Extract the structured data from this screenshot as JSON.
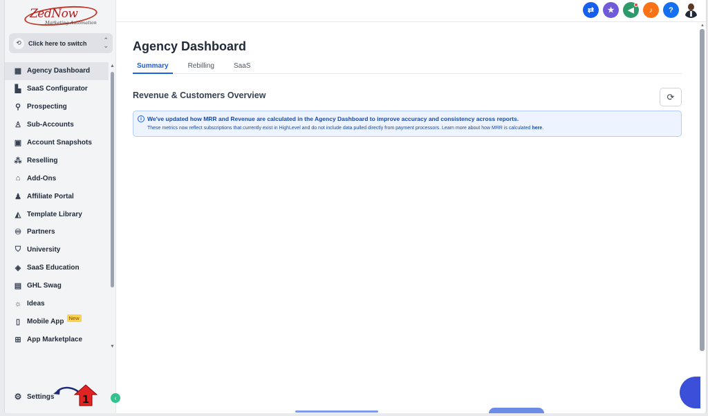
{
  "logo": {
    "brand": "ZedNow",
    "tagline": "Marketing Automation"
  },
  "switcher": {
    "label": "Click here to switch"
  },
  "sidebar": {
    "items": [
      {
        "label": "Agency Dashboard",
        "icon": "dashboard-icon",
        "glyph": "▦",
        "active": true
      },
      {
        "label": "SaaS Configurator",
        "icon": "bar-chart-icon",
        "glyph": "▙"
      },
      {
        "label": "Prospecting",
        "icon": "users-search-icon",
        "glyph": "⚲"
      },
      {
        "label": "Sub-Accounts",
        "icon": "user-icon",
        "glyph": "♙"
      },
      {
        "label": "Account Snapshots",
        "icon": "image-icon",
        "glyph": "▣"
      },
      {
        "label": "Reselling",
        "icon": "network-icon",
        "glyph": "⁂"
      },
      {
        "label": "Add-Ons",
        "icon": "bag-icon",
        "glyph": "⌂"
      },
      {
        "label": "Affiliate Portal",
        "icon": "group-icon",
        "glyph": "♟"
      },
      {
        "label": "Template Library",
        "icon": "shapes-icon",
        "glyph": "◭"
      },
      {
        "label": "Partners",
        "icon": "handshake-icon",
        "glyph": "♾"
      },
      {
        "label": "University",
        "icon": "graduation-cap-icon",
        "glyph": "⛉"
      },
      {
        "label": "SaaS Education",
        "icon": "cube-icon",
        "glyph": "◈"
      },
      {
        "label": "GHL Swag",
        "icon": "store-icon",
        "glyph": "▤"
      },
      {
        "label": "Ideas",
        "icon": "bulb-icon",
        "glyph": "☼"
      },
      {
        "label": "Mobile App",
        "icon": "phone-icon",
        "glyph": "▯",
        "badge": "New"
      },
      {
        "label": "App Marketplace",
        "icon": "grid-icon",
        "glyph": "⊞"
      }
    ],
    "settings_label": "Settings"
  },
  "annotation": {
    "step_number": "1",
    "marker_color": "#e02424"
  },
  "header": {
    "title": "Agency Dashboard",
    "tabs": [
      {
        "label": "Summary",
        "active": true
      },
      {
        "label": "Rebilling"
      },
      {
        "label": "SaaS"
      }
    ]
  },
  "topbar_icons": [
    {
      "name": "switch-icon",
      "color": "#155eef",
      "glyph": "⇄"
    },
    {
      "name": "star-icon",
      "color": "#6f5bd7",
      "glyph": "★"
    },
    {
      "name": "megaphone-icon",
      "color": "#2e9a6a",
      "glyph": "◀",
      "dot": true
    },
    {
      "name": "bell-icon",
      "color": "#f97316",
      "glyph": "♪"
    },
    {
      "name": "help-icon",
      "color": "#1570ef",
      "glyph": "?"
    }
  ],
  "section": {
    "title": "Revenue & Customers Overview"
  },
  "notice": {
    "title": "We've updated how MRR and Revenue are calculated in the Agency Dashboard to improve accuracy and consistency across reports.",
    "body": "These metrics now reflect subscriptions that currently exist in HighLevel and do not include data pulled directly from payment processors. Learn more about how MRR is calculated ",
    "link": "here",
    "period": "."
  },
  "colors": {
    "accent": "#155eef",
    "notice_bg": "#eef4ff"
  }
}
